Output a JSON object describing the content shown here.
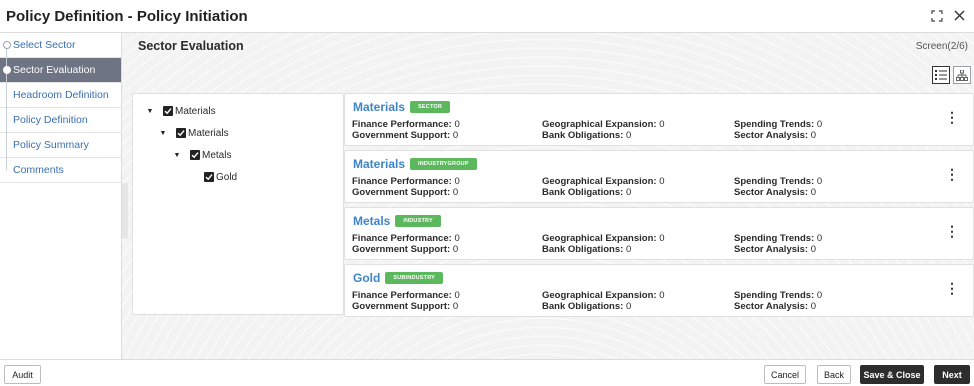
{
  "window": {
    "title": "Policy Definition - Policy Initiation",
    "expand_icon": "expand-icon",
    "close_icon": "close-icon"
  },
  "sidebar": {
    "items": [
      {
        "label": "Select Sector",
        "state": "done"
      },
      {
        "label": "Sector Evaluation",
        "state": "active"
      },
      {
        "label": "Headroom Definition",
        "state": "todo"
      },
      {
        "label": "Policy Definition",
        "state": "todo"
      },
      {
        "label": "Policy Summary",
        "state": "todo"
      },
      {
        "label": "Comments",
        "state": "todo"
      }
    ]
  },
  "main": {
    "section_title": "Sector Evaluation",
    "screen_counter": "Screen(2/6)",
    "view_toggle": {
      "list_icon": "list-view-icon",
      "tree_icon": "hierarchy-view-icon"
    }
  },
  "tree": [
    {
      "label": "Materials",
      "checked": true,
      "expanded": true,
      "level": 0
    },
    {
      "label": "Materials",
      "checked": true,
      "expanded": true,
      "level": 1
    },
    {
      "label": "Metals",
      "checked": true,
      "expanded": true,
      "level": 2
    },
    {
      "label": "Gold",
      "checked": true,
      "expanded": false,
      "level": 3
    }
  ],
  "cards": [
    {
      "name": "Materials",
      "badge": "SECTOR",
      "finance_label": "Finance Performance:",
      "finance_value": "0",
      "geo_label": "Geographical Expansion:",
      "geo_value": "0",
      "spending_label": "Spending Trends:",
      "spending_value": "0",
      "gov_label": "Government Support:",
      "gov_value": "0",
      "bank_label": "Bank Obligations:",
      "bank_value": "0",
      "sector_label": "Sector Analysis:",
      "sector_value": "0"
    },
    {
      "name": "Materials",
      "badge": "INDUSTRYGROUP",
      "finance_label": "Finance Performance:",
      "finance_value": "0",
      "geo_label": "Geographical Expansion:",
      "geo_value": "0",
      "spending_label": "Spending Trends:",
      "spending_value": "0",
      "gov_label": "Government Support:",
      "gov_value": "0",
      "bank_label": "Bank Obligations:",
      "bank_value": "0",
      "sector_label": "Sector Analysis:",
      "sector_value": "0"
    },
    {
      "name": "Metals",
      "badge": "INDUSTRY",
      "finance_label": "Finance Performance:",
      "finance_value": "0",
      "geo_label": "Geographical Expansion:",
      "geo_value": "0",
      "spending_label": "Spending Trends:",
      "spending_value": "0",
      "gov_label": "Government Support:",
      "gov_value": "0",
      "bank_label": "Bank Obligations:",
      "bank_value": "0",
      "sector_label": "Sector Analysis:",
      "sector_value": "0"
    },
    {
      "name": "Gold",
      "badge": "SUBINDUSTRY",
      "finance_label": "Finance Performance:",
      "finance_value": "0",
      "geo_label": "Geographical Expansion:",
      "geo_value": "0",
      "spending_label": "Spending Trends:",
      "spending_value": "0",
      "gov_label": "Government Support:",
      "gov_value": "0",
      "bank_label": "Bank Obligations:",
      "bank_value": "0",
      "sector_label": "Sector Analysis:",
      "sector_value": "0"
    }
  ],
  "footer": {
    "audit": "Audit",
    "cancel": "Cancel",
    "back": "Back",
    "save_close": "Save & Close",
    "next": "Next"
  },
  "colors": {
    "accent_blue": "#3f84c6",
    "badge_green": "#5cb85c",
    "active_step": "#6e7483",
    "dark_button": "#2d2d2d"
  }
}
